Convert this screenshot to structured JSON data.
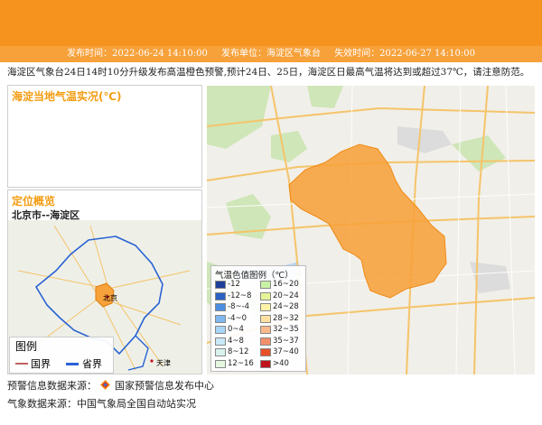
{
  "meta": {
    "publish_time": "发布时间：2022-06-24 14:10:00",
    "publisher": "发布单位：海淀区气象台",
    "expire_time": "失效时间：2022-06-27 14:10:00"
  },
  "notice": "海淀区气象台24日14时10分升级发布高温橙色预警,预计24日、25日，海淀区日最高气温将达到或超过37℃，请注意防范。",
  "temp_panel": {
    "title": "海淀当地气温实况(℃)"
  },
  "locate_panel": {
    "title": "定位概览",
    "district": "北京市--海淀区"
  },
  "mini_map": {
    "legend_title": "图例",
    "legend_items": [
      "国界",
      "省界"
    ],
    "labels": [
      "北京",
      "天津"
    ]
  },
  "temp_legend": {
    "title": "气温色值图例（℃）",
    "items": [
      {
        "label": "-12",
        "color": "#1f3f9a"
      },
      {
        "label": "16~20",
        "color": "#c9f2a6"
      },
      {
        "label": "-12~8",
        "color": "#2a62c4"
      },
      {
        "label": "20~24",
        "color": "#e6f59a"
      },
      {
        "label": "-8~-4",
        "color": "#4a8ee0"
      },
      {
        "label": "24~28",
        "color": "#fff3a8"
      },
      {
        "label": "-4~0",
        "color": "#7fb8f0"
      },
      {
        "label": "28~32",
        "color": "#ffe0a3"
      },
      {
        "label": "0~4",
        "color": "#a8d6f6"
      },
      {
        "label": "32~35",
        "color": "#f9b98a"
      },
      {
        "label": "4~8",
        "color": "#c9e8f8"
      },
      {
        "label": "35~37",
        "color": "#f38f6b"
      },
      {
        "label": "8~12",
        "color": "#d9f2ee"
      },
      {
        "label": "37~40",
        "color": "#e8502a"
      },
      {
        "label": "12~16",
        "color": "#e6f7e0"
      },
      {
        "label": ">40",
        "color": "#c0141c"
      }
    ]
  },
  "footer": {
    "warning_source": "预警信息数据来源：",
    "warning_center": "国家预警信息发布中心",
    "weather_source": "气象数据来源：中国气象局全国自动站实况"
  },
  "colors": {
    "accent": "#f6921e",
    "region_fill": "#f7a23a",
    "province_border": "#2a62d4"
  }
}
